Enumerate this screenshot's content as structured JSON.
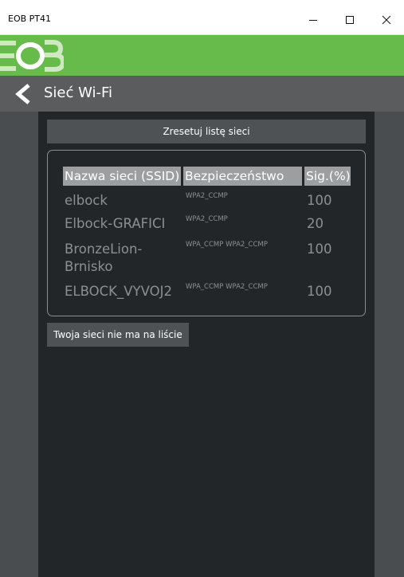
{
  "window": {
    "title": "EOB PT41"
  },
  "brand": {
    "logo_name": "EOB"
  },
  "nav": {
    "title": "Sieć Wi-Fi"
  },
  "actions": {
    "reset_label": "Zresetuj listę sieci",
    "missing_label": "Twoja sieci nie ma na liście"
  },
  "table": {
    "headers": {
      "ssid": "Nazwa sieci (SSID)",
      "security": "Bezpieczeństwo",
      "signal": "Sig.(%)"
    },
    "rows": [
      {
        "ssid": "elbock",
        "security": "WPA2_CCMP",
        "signal": "100"
      },
      {
        "ssid": "Elbock-GRAFICI",
        "security": "WPA2_CCMP",
        "signal": "20"
      },
      {
        "ssid": "BronzeLion-Brnisko",
        "security": "WPA_CCMP WPA2_CCMP",
        "signal": "100"
      },
      {
        "ssid": "ELBOCK_VYVOJ2",
        "security": "WPA_CCMP WPA2_CCMP",
        "signal": "100"
      }
    ]
  },
  "colors": {
    "brand_green": "#66bb4a",
    "nav_gray": "#5a5c5e",
    "panel_dark": "#232628",
    "header_gray": "#9c9e9f"
  }
}
